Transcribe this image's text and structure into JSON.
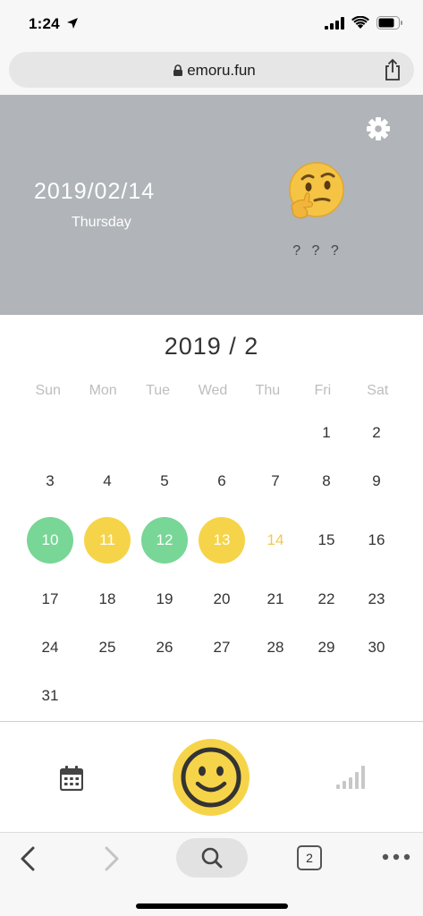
{
  "status_bar": {
    "time": "1:24"
  },
  "browser": {
    "url": "emoru.fun"
  },
  "header": {
    "date": "2019/02/14",
    "weekday": "Thursday",
    "mood_label": "? ? ?",
    "emoji_icon": "thinking-face-icon"
  },
  "calendar": {
    "title": "2019 / 2",
    "weekdays": [
      "Sun",
      "Mon",
      "Tue",
      "Wed",
      "Thu",
      "Fri",
      "Sat"
    ],
    "weeks": [
      [
        "",
        "",
        "",
        "",
        "",
        "1",
        "2"
      ],
      [
        "3",
        "4",
        "5",
        "6",
        "7",
        "8",
        "9"
      ],
      [
        "10",
        "11",
        "12",
        "13",
        "14",
        "15",
        "16"
      ],
      [
        "17",
        "18",
        "19",
        "20",
        "21",
        "22",
        "23"
      ],
      [
        "24",
        "25",
        "26",
        "27",
        "28",
        "29",
        "30"
      ],
      [
        "31",
        "",
        "",
        "",
        "",
        "",
        ""
      ]
    ],
    "marked_days": {
      "10": "green",
      "11": "yellow",
      "12": "green",
      "13": "yellow"
    },
    "today": "14",
    "colors": {
      "green": "#78d696",
      "yellow": "#f6d449",
      "today_text": "#f2c94c"
    }
  },
  "app_nav": {
    "icons": [
      "calendar-icon",
      "smiley-face-icon",
      "signal-bars-icon"
    ]
  },
  "toolbar": {
    "tabs_count": "2"
  }
}
